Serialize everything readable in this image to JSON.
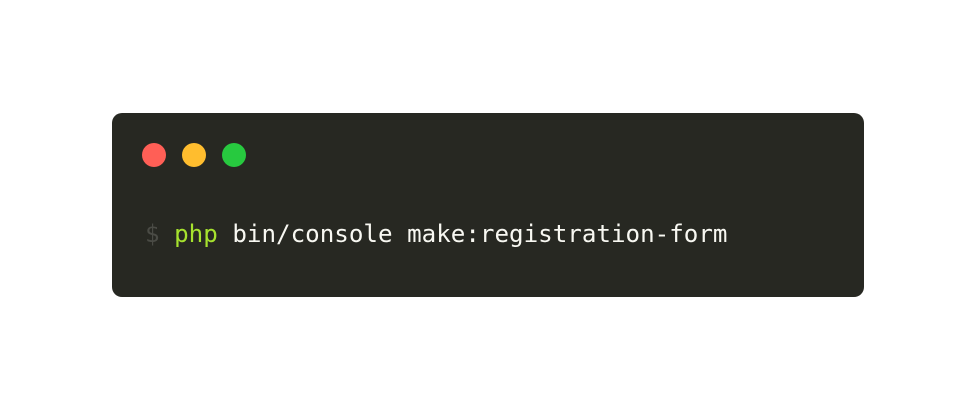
{
  "terminal": {
    "window_buttons": [
      {
        "name": "close",
        "color": "#ff5f56"
      },
      {
        "name": "minimize",
        "color": "#ffbd2e"
      },
      {
        "name": "zoom",
        "color": "#27c93f"
      }
    ],
    "prompt_symbol": "$",
    "command": "php",
    "arguments": "bin/console make:registration-form",
    "colors": {
      "background": "#272822",
      "prompt": "#4a4b45",
      "command": "#a6e22e",
      "text": "#f8f8f2"
    }
  }
}
